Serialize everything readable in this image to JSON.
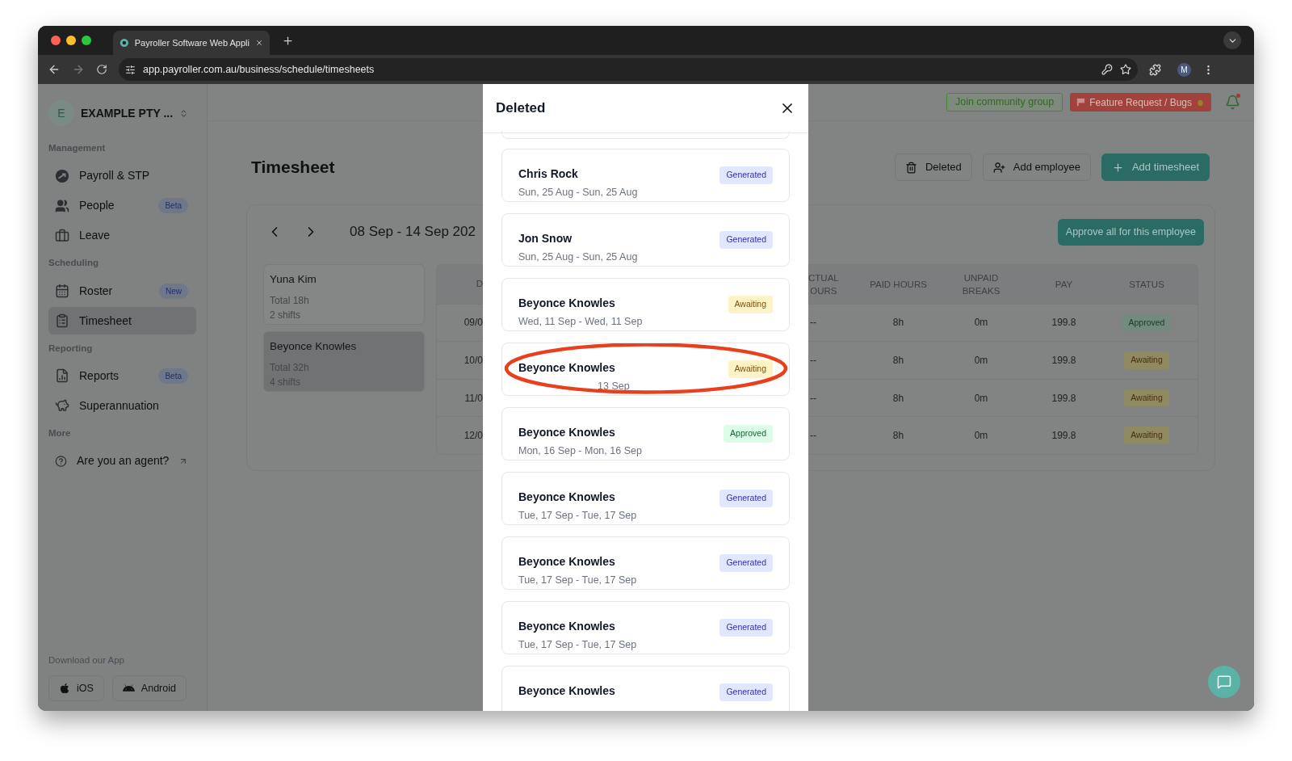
{
  "browser": {
    "tab_title": "Payroller Software Web Appli",
    "url": "app.payroller.com.au/business/schedule/timesheets",
    "profile_initial": "M"
  },
  "sidebar": {
    "company_initial": "E",
    "company_name": "EXAMPLE PTY ...",
    "sections": [
      {
        "label": "Management",
        "items": [
          {
            "label": "Payroll & STP",
            "selected": false
          },
          {
            "label": "People",
            "badge": "Beta",
            "selected": false
          },
          {
            "label": "Leave",
            "selected": false
          }
        ]
      },
      {
        "label": "Scheduling",
        "items": [
          {
            "label": "Roster",
            "badge": "New",
            "selected": false
          },
          {
            "label": "Timesheet",
            "selected": true
          }
        ]
      },
      {
        "label": "Reporting",
        "items": [
          {
            "label": "Reports",
            "badge": "Beta",
            "selected": false
          },
          {
            "label": "Superannuation",
            "selected": false
          }
        ]
      },
      {
        "label": "More",
        "items": [
          {
            "label": "Are you an agent?",
            "external": true,
            "selected": false
          }
        ]
      }
    ],
    "download_label": "Download our App",
    "app_buttons": [
      {
        "label": "iOS"
      },
      {
        "label": "Android"
      }
    ]
  },
  "header": {
    "community_button": "Join community group",
    "feature_button": "Feature Request / Bugs"
  },
  "page": {
    "title": "Timesheet",
    "buttons": [
      {
        "label": "Deleted",
        "kind": "outline"
      },
      {
        "label": "Add employee",
        "kind": "outline"
      },
      {
        "label": "Add timesheet",
        "kind": "primary"
      }
    ]
  },
  "timesheet": {
    "range": "08 Sep - 14 Sep 202",
    "approve_button": "Approve all for this employee",
    "employees": [
      {
        "name": "Yuna Kim",
        "total": "Total 18h",
        "shifts": "2 shifts",
        "selected": false
      },
      {
        "name": "Beyonce Knowles",
        "total": "Total 32h",
        "shifts": "4 shifts",
        "selected": true
      }
    ],
    "table": {
      "columns": [
        {
          "lines": [
            "D"
          ]
        },
        {
          "lines": [
            "CTUAL",
            "OURS"
          ]
        },
        {
          "lines": [
            "PAID HOURS"
          ]
        },
        {
          "lines": [
            "UNPAID",
            "BREAKS"
          ]
        },
        {
          "lines": [
            "PAY"
          ]
        },
        {
          "lines": [
            "STATUS"
          ]
        }
      ],
      "rows": [
        {
          "cells": [
            "09/0",
            "--",
            "8h",
            "0m",
            "199.8"
          ],
          "status": "Approved",
          "kind": "approved"
        },
        {
          "cells": [
            "10/0",
            "--",
            "8h",
            "0m",
            "199.8"
          ],
          "status": "Awaiting",
          "kind": "awaiting"
        },
        {
          "cells": [
            "11/0",
            "--",
            "8h",
            "0m",
            "199.8"
          ],
          "status": "Awaiting",
          "kind": "awaiting"
        },
        {
          "cells": [
            "12/0",
            "--",
            "8h",
            "0m",
            "199.8"
          ],
          "status": "Awaiting",
          "kind": "awaiting"
        }
      ]
    }
  },
  "modal": {
    "title": "Deleted",
    "items": [
      {
        "name": "Chris Rock",
        "dates": "Sun, 25 Aug - Sun, 25 Aug",
        "status": "Generated",
        "kind": "generated",
        "highlighted": false
      },
      {
        "name": "Jon Snow",
        "dates": "Sun, 25 Aug - Sun, 25 Aug",
        "status": "Generated",
        "kind": "generated",
        "highlighted": false
      },
      {
        "name": "Beyonce Knowles",
        "dates": "Wed, 11 Sep - Wed, 11 Sep",
        "status": "Awaiting",
        "kind": "awaiting",
        "highlighted": false
      },
      {
        "name": "Beyonce Knowles",
        "dates": "13 Sep",
        "status": "Awaiting",
        "kind": "awaiting",
        "highlighted": true
      },
      {
        "name": "Beyonce Knowles",
        "dates": "Mon, 16 Sep - Mon, 16 Sep",
        "status": "Approved",
        "kind": "approved",
        "highlighted": false
      },
      {
        "name": "Beyonce Knowles",
        "dates": "Tue, 17 Sep - Tue, 17 Sep",
        "status": "Generated",
        "kind": "generated",
        "highlighted": false
      },
      {
        "name": "Beyonce Knowles",
        "dates": "Tue, 17 Sep - Tue, 17 Sep",
        "status": "Generated",
        "kind": "generated",
        "highlighted": false
      },
      {
        "name": "Beyonce Knowles",
        "dates": "Tue, 17 Sep - Tue, 17 Sep",
        "status": "Generated",
        "kind": "generated",
        "highlighted": false
      },
      {
        "name": "Beyonce Knowles",
        "status": "Generated",
        "kind": "generated",
        "highlighted": false
      }
    ]
  }
}
